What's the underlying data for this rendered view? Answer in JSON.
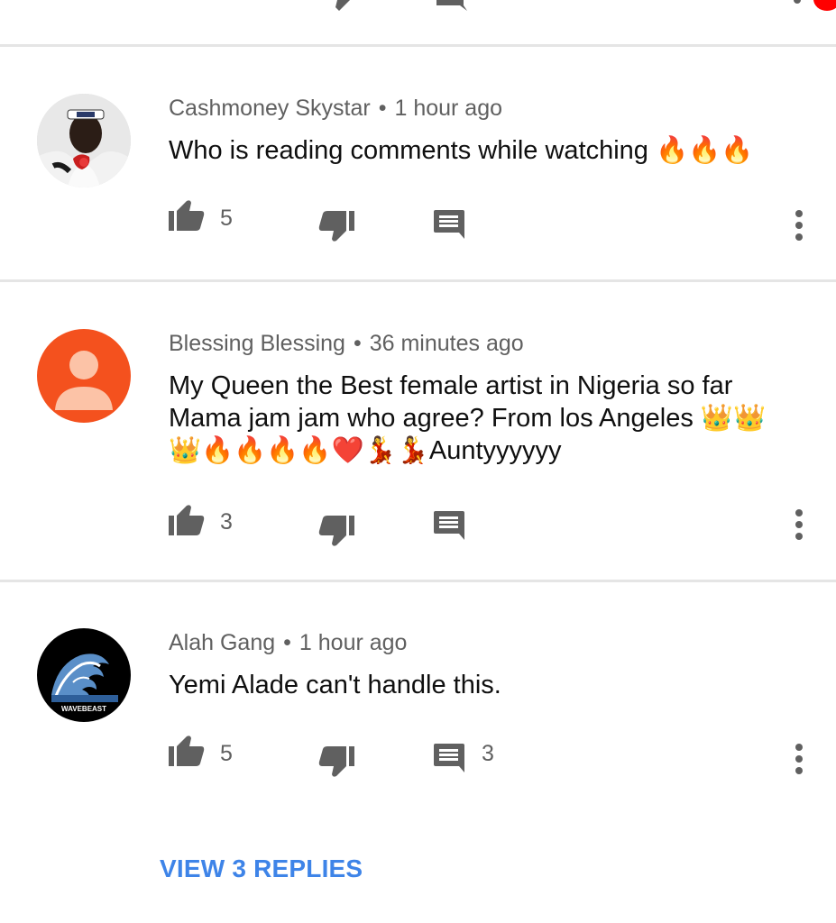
{
  "comments": [
    {
      "author": "Cashmoney Skystar",
      "time": "1 hour ago",
      "text": "Who is reading comments while watching 🔥🔥🔥",
      "likes": "5",
      "replies": ""
    },
    {
      "author": "Blessing Blessing",
      "time": "36 minutes ago",
      "text": "My Queen the Best female artist in Nigeria so far Mama jam jam who agree? From los Angeles 👑👑👑🔥🔥🔥🔥❤️💃💃Auntyyyyyy",
      "likes": "3",
      "replies": ""
    },
    {
      "author": "Alah Gang",
      "time": "1 hour ago",
      "text": "Yemi Alade can't handle this.",
      "likes": "5",
      "replies": "3"
    }
  ],
  "separator": "•",
  "view_replies_label": "VIEW 3 REPLIES",
  "avatar_wave_label": "WAVEBEAST",
  "colors": {
    "meta_text": "#606060",
    "body_text": "#0f0f0f",
    "link_blue": "#3e84e8",
    "divider": "#e5e5e5",
    "avatar_orange": "#f4511e"
  }
}
